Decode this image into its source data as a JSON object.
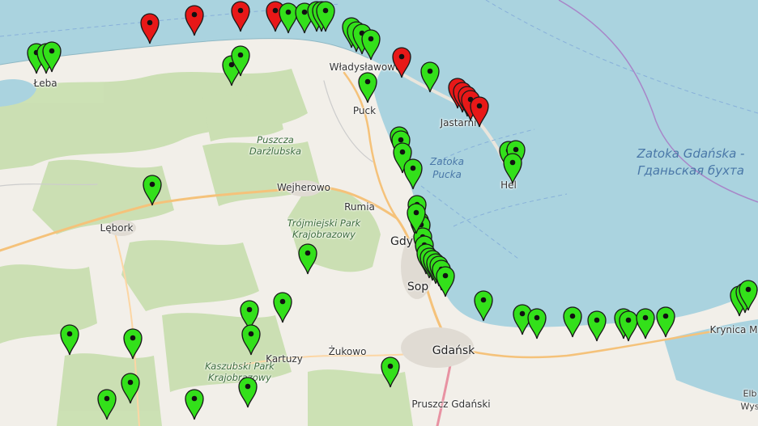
{
  "map": {
    "labels": {
      "leba": "Łeba",
      "wladyslawowo": "Władysławowo",
      "puck": "Puck",
      "jastarnia": "Jastarni",
      "hel": "Hel",
      "puszcza": "Puszcza Darżlubska",
      "zatoka_pucka": "Zatoka Pucka",
      "zatoka_gdanska": "Zatoka Gdańska - Гданьская бухта",
      "wejherowo": "Wejherowo",
      "rumia": "Rumia",
      "lebork": "Lębork",
      "tpk": "Trójmiejski Park Krajobrazowy",
      "gdynia": "Gdy",
      "sopot": "Sop",
      "kartuzy": "Kartuzy",
      "zukowo": "Żukowo",
      "gdansk": "Gdańsk",
      "kaszubski": "Kaszubski Park Krajobrazowy",
      "pruszcz": "Pruszcz Gdański",
      "krynica": "Krynica M",
      "elb": "Elb",
      "wys": "Wys"
    },
    "colors": {
      "water": "#aad3df",
      "land": "#f2efe9",
      "forest": "#c8e0b0",
      "ok_marker": "#33e01a",
      "alert_marker": "#e81818"
    },
    "marker_icon": "map-pin-icon",
    "markers": [
      {
        "status": "ok"
      },
      {
        "status": "ok"
      },
      {
        "status": "ok"
      },
      {
        "status": "alert"
      },
      {
        "status": "alert"
      },
      {
        "status": "alert"
      },
      {
        "status": "alert"
      },
      {
        "status": "ok"
      },
      {
        "status": "ok"
      },
      {
        "status": "ok"
      },
      {
        "status": "ok"
      },
      {
        "status": "ok"
      },
      {
        "status": "ok"
      },
      {
        "status": "ok"
      },
      {
        "status": "ok"
      },
      {
        "status": "ok"
      },
      {
        "status": "alert"
      },
      {
        "status": "ok"
      },
      {
        "status": "alert"
      },
      {
        "status": "alert"
      },
      {
        "status": "alert"
      },
      {
        "status": "alert"
      },
      {
        "status": "alert"
      },
      {
        "status": "ok"
      },
      {
        "status": "ok"
      },
      {
        "status": "ok"
      },
      {
        "status": "ok"
      },
      {
        "status": "ok"
      },
      {
        "status": "ok"
      },
      {
        "status": "ok"
      },
      {
        "status": "ok"
      },
      {
        "status": "ok"
      },
      {
        "status": "ok"
      },
      {
        "status": "ok"
      },
      {
        "status": "ok"
      },
      {
        "status": "ok"
      },
      {
        "status": "ok"
      },
      {
        "status": "ok"
      },
      {
        "status": "ok"
      },
      {
        "status": "ok"
      },
      {
        "status": "ok"
      },
      {
        "status": "ok"
      },
      {
        "status": "ok"
      },
      {
        "status": "ok"
      },
      {
        "status": "ok"
      },
      {
        "status": "ok"
      },
      {
        "status": "ok"
      },
      {
        "status": "ok"
      },
      {
        "status": "ok"
      },
      {
        "status": "ok"
      },
      {
        "status": "ok"
      },
      {
        "status": "ok"
      },
      {
        "status": "ok"
      },
      {
        "status": "ok"
      },
      {
        "status": "ok"
      },
      {
        "status": "ok"
      },
      {
        "status": "ok"
      },
      {
        "status": "ok"
      },
      {
        "status": "ok"
      },
      {
        "status": "ok"
      },
      {
        "status": "ok"
      },
      {
        "status": "ok"
      },
      {
        "status": "ok"
      },
      {
        "status": "ok"
      },
      {
        "status": "ok"
      },
      {
        "status": "ok"
      },
      {
        "status": "ok"
      },
      {
        "status": "ok"
      },
      {
        "status": "ok"
      },
      {
        "status": "ok"
      }
    ]
  }
}
